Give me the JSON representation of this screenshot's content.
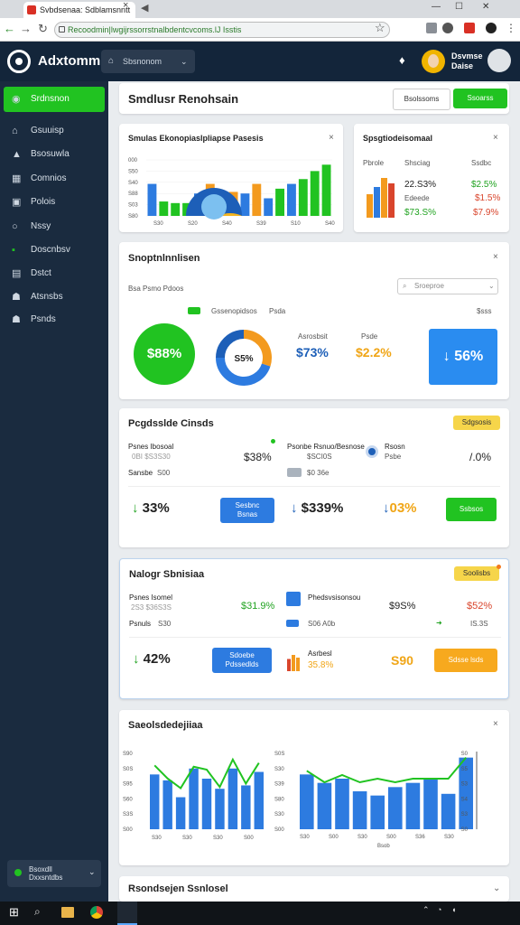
{
  "browser": {
    "tab_title": "Svbdsenaa: Sdblamsnntt",
    "url": "Recoodmin|lwgijrssorrstnalbdentcvcoms.lJ Isstis"
  },
  "app": {
    "title": "Adxtommi",
    "workspace": "Sbsnonom",
    "user": "Dsvmse\nDaise"
  },
  "sidebar": {
    "items": [
      {
        "label": "Srdnsnon",
        "icon": "dashboard-icon"
      },
      {
        "label": "Gsuuisp",
        "icon": "home-icon"
      },
      {
        "label": "Bsosuwla",
        "icon": "chart-icon"
      },
      {
        "label": "Comnios",
        "icon": "calendar-icon"
      },
      {
        "label": "Polois",
        "icon": "folder-icon"
      },
      {
        "label": "Nssy",
        "icon": "circle-icon"
      },
      {
        "label": "Doscnbsv",
        "icon": "badge-icon"
      },
      {
        "label": "Dstct",
        "icon": "grid-icon"
      },
      {
        "label": "Atsnsbs",
        "icon": "users-icon"
      },
      {
        "label": "Psnds",
        "icon": "people-icon"
      }
    ],
    "footer": "Bsoxdll\nDxxsntdbs"
  },
  "page": {
    "title": "Smdlusr Renohsain",
    "btn_secondary": "Bsolssoms",
    "btn_primary": "Ssoarss"
  },
  "card1": {
    "title": "Smulas Ekonopiaslpliapse Pasesis",
    "yticks": [
      "S80",
      "S03",
      "S88",
      "S40",
      "S50",
      "000"
    ],
    "xticks": [
      "S30",
      "S20",
      "S40",
      "S39",
      "S10",
      "S40"
    ]
  },
  "card2": {
    "title": "Spsgtiodeisomaal",
    "h1": "Pbrole",
    "h2": "Shsciag",
    "h3": "Ssdbc",
    "r1": {
      "a": "22.S3%",
      "b": "$2.5%"
    },
    "r2": {
      "a": "Edeede",
      "b": "$1.5%"
    },
    "r3": {
      "a": "$73.S%",
      "b": "$7.9%"
    }
  },
  "card3": {
    "title": "Snoptnlnnlisen",
    "sub": "Bsa Psmo Pdoos",
    "search": "Sroeproe",
    "chip": "Gssenopidsos",
    "tag": "Psda",
    "right": "$sss",
    "circle": "$88%",
    "donut": "S5%",
    "m1label": "Asrosbsit",
    "m1": "$73%",
    "m2label": "Psde",
    "m2": "$2.2%",
    "tile": "56%"
  },
  "card4": {
    "title": "Pcgdsslde Cinsds",
    "badge": "Sdgsosis",
    "l1": "Psnes Ibosoal",
    "l1s": "0BI $S3S30",
    "l1v": "$38%",
    "l2": "Psonbe Rsnuo/Besnose",
    "l2s": "$SCI0S",
    "l3": "Rsosn",
    "l3s": "Psbe",
    "r": "/.0%",
    "sl": "Sansbe",
    "sv": "S00",
    "sv2": "$0 36e",
    "sv3": "S00",
    "p1": "33%",
    "p2": "$339%",
    "p3": "03%",
    "b1": "Sesbnc\nBsnas",
    "b2": "Ssbsos"
  },
  "card5": {
    "title": "Nalogr Sbnisiaa",
    "badge": "Soolisbs",
    "l1": "Psnes Isomel",
    "l1s": "2S3 $36S3S",
    "l1v": "$31.9%",
    "l2": "Phedsvsisonsou",
    "l3": "$9S%",
    "l4": "$52%",
    "sl": "Psnuls",
    "sv": "S30",
    "sv2": "S06 A0b",
    "sv3": "IS.3S",
    "p1": "42%",
    "b1": "Sdoebe\nPdssedlds",
    "p2label": "Asrbesl",
    "p2": "35.8%",
    "p3": "S90",
    "b2": "Sdsse lsds"
  },
  "card6": {
    "title": "Saeolsdedejiiaa",
    "y1": [
      "S00",
      "S3S",
      "S60",
      "S95",
      "S0S",
      "S90"
    ],
    "x1": [
      "S30",
      "S30",
      "S30",
      "S00"
    ],
    "y2": [
      "S00",
      "S30",
      "S80",
      "S39",
      "S30",
      "S0S"
    ],
    "x2": [
      "S30",
      "S00",
      "S30",
      "S00",
      "S36",
      "S30"
    ],
    "xlabel": "Bsob",
    "right": [
      "S0",
      "S3",
      "S4",
      "S3",
      "S5",
      "S0"
    ]
  },
  "card7": {
    "title": "Rsondsejen Ssnlosel"
  },
  "chart_data": [
    {
      "type": "bar",
      "categories": [
        "1",
        "2",
        "3",
        "4",
        "5",
        "6",
        "7",
        "8",
        "9",
        "10",
        "11",
        "12",
        "13",
        "14",
        "15",
        "16"
      ],
      "values": [
        40,
        18,
        16,
        16,
        28,
        40,
        22,
        30,
        28,
        40,
        22,
        34,
        40,
        46,
        56,
        64
      ]
    },
    {
      "type": "bar",
      "categories": [
        "1",
        "2",
        "3",
        "4",
        "5",
        "6",
        "7",
        "8",
        "9"
      ],
      "values": [
        65,
        58,
        38,
        72,
        60,
        48,
        72,
        52,
        68
      ]
    },
    {
      "type": "bar",
      "categories": [
        "1",
        "2",
        "3",
        "4",
        "5",
        "6",
        "7",
        "8",
        "9",
        "10"
      ],
      "values": [
        65,
        55,
        60,
        45,
        40,
        50,
        55,
        60,
        42,
        85
      ]
    },
    {
      "type": "bar",
      "categories": [
        "1",
        "2",
        "3"
      ],
      "values": [
        54,
        72,
        60
      ]
    }
  ],
  "colors": {
    "green": "#21c321",
    "blue": "#2d7be0",
    "orange": "#f39a1e",
    "navy": "#13253a"
  }
}
